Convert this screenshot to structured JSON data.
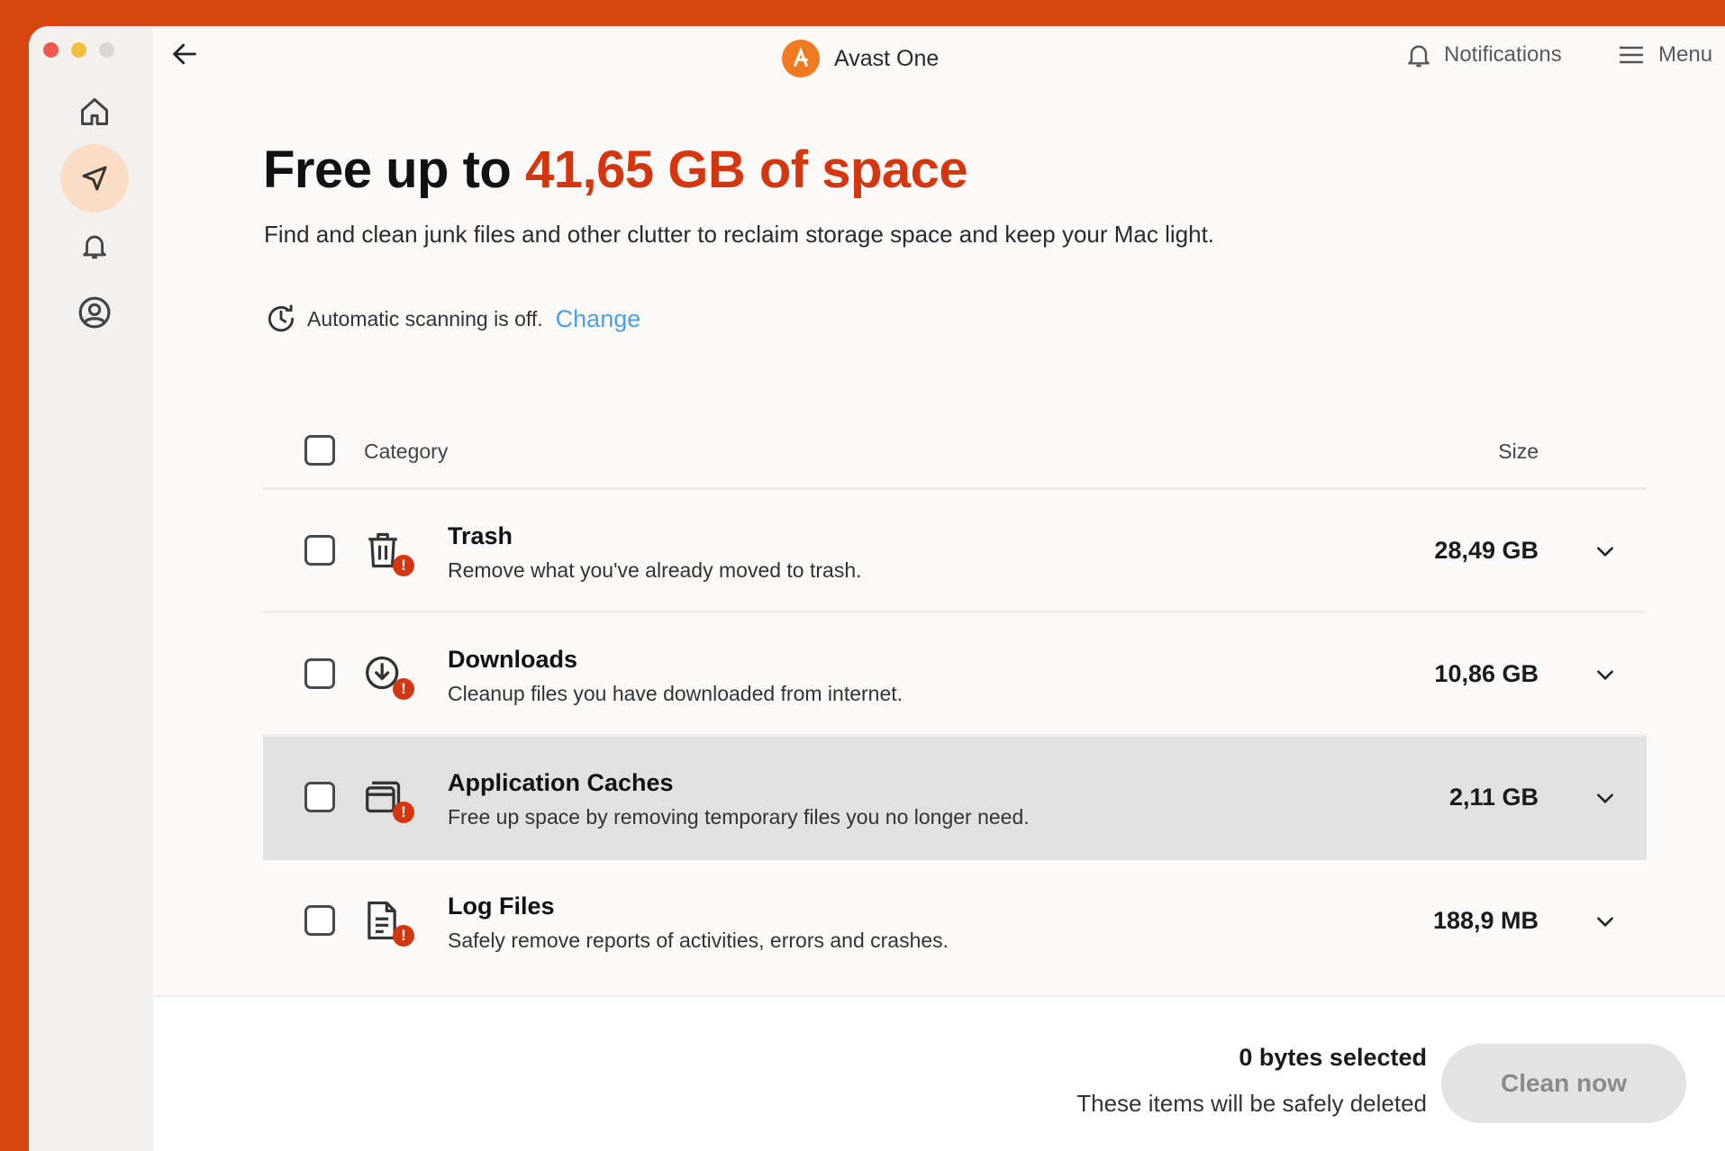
{
  "app": {
    "name": "Avast One"
  },
  "header": {
    "notifications_label": "Notifications",
    "menu_label": "Menu"
  },
  "sidebar": {
    "items": [
      {
        "icon": "home-icon"
      },
      {
        "icon": "navigate-icon",
        "active": true
      },
      {
        "icon": "bell-icon"
      },
      {
        "icon": "account-icon"
      }
    ]
  },
  "hero": {
    "title_prefix": "Free up to ",
    "title_accent": "41,65 GB of space",
    "subtitle": "Find and clean junk files and other clutter to reclaim storage space and keep your Mac light.",
    "autoscan_text": "Automatic scanning is off.",
    "autoscan_link": "Change"
  },
  "table": {
    "col_category": "Category",
    "col_size": "Size",
    "rows": [
      {
        "title": "Trash",
        "desc": "Remove what you've already moved to trash.",
        "size": "28,49 GB",
        "icon": "trash-icon"
      },
      {
        "title": "Downloads",
        "desc": "Cleanup files you have downloaded from internet.",
        "size": "10,86 GB",
        "icon": "download-icon"
      },
      {
        "title": "Application Caches",
        "desc": "Free up space by removing temporary files you no longer need.",
        "size": "2,11 GB",
        "icon": "app-cache-icon",
        "highlighted": true
      },
      {
        "title": "Log Files",
        "desc": "Safely remove reports of activities, errors and crashes.",
        "size": "188,9 MB",
        "icon": "log-file-icon"
      }
    ]
  },
  "footer": {
    "selected": "0 bytes selected",
    "note": "These items will be safely deleted",
    "clean_button": "Clean now"
  },
  "colors": {
    "accent": "#d4360f",
    "link": "#4b9ee8",
    "background": "#d5470f"
  }
}
